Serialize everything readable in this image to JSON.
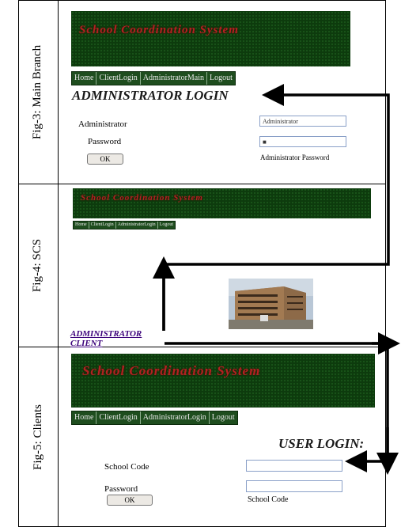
{
  "figures": [
    {
      "label": "Fig-3: Main Branch",
      "banner_title": "School Coordination System",
      "nav": [
        "Home",
        "ClientLogin",
        "AdministratorMain",
        "Logout"
      ],
      "heading": "ADMINISTRATOR  LOGIN",
      "fields": [
        {
          "label": "Administrator",
          "value": "Administrator"
        },
        {
          "label": "Password",
          "value": "■"
        }
      ],
      "button": "OK",
      "hint": "Administrator Password"
    },
    {
      "label": "Fig-4: SCS",
      "banner_title": "School Coordination System",
      "nav": [
        "Home",
        "ClientLogin",
        "AdministratorLogin",
        "Logout"
      ],
      "links": [
        "ADMINISTRATOR",
        "CLIENT"
      ]
    },
    {
      "label": "Fig-5: Clients",
      "banner_title": "School Coordination System",
      "nav": [
        "Home",
        "ClientLogin",
        "AdministratorLogin",
        "Logout"
      ],
      "heading": "USER LOGIN:",
      "fields": [
        {
          "label": "School Code",
          "value": ""
        },
        {
          "label": "Password",
          "value": ""
        }
      ],
      "button": "OK",
      "hint": "School Code"
    }
  ]
}
